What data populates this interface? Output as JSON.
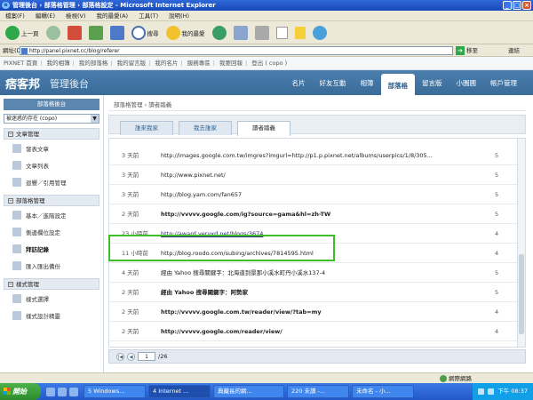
{
  "window": {
    "title": "管理後台 › 部落格管理 › 部落格設定 - Microsoft Internet Explorer",
    "min": "_",
    "max": "□",
    "close": "×"
  },
  "menubar": [
    "檔案(F)",
    "編輯(E)",
    "檢視(V)",
    "我的最愛(A)",
    "工具(T)",
    "說明(H)"
  ],
  "toolbar": {
    "back": "上一頁",
    "search": "搜尋",
    "favorites": "我的最愛"
  },
  "address": {
    "label": "網址(D)",
    "url": "http://panel.pixnet.cc/blog/referer",
    "go": "移至",
    "links": "連結"
  },
  "pixnav": [
    "PIXNET 首頁",
    "我的相簿",
    "我的部落格",
    "我的留言版",
    "我的名片",
    "服務專區",
    "我要回報",
    "登出 ( copo )"
  ],
  "header": {
    "logo": "痞客邦",
    "subtitle": "管理後台",
    "tabs": [
      "名片",
      "好友互動",
      "相簿",
      "部落格",
      "留言版",
      "小園圃",
      "帳戶管理"
    ],
    "active_tab": "部落格"
  },
  "sidebar": {
    "title": "部落格後台",
    "selected_blog": "被迷惑的存在 (copo)",
    "groups": [
      {
        "title": "文章管理",
        "items": [
          "發表文章",
          "文章列表",
          "迴響／引用管理"
        ]
      },
      {
        "title": "部落格管理",
        "items": [
          "基本／進階設定",
          "側邊欄位設定",
          "拜訪記錄",
          "匯入匯出備份"
        ]
      },
      {
        "title": "樣式管理",
        "items": [
          "樣式選擇",
          "樣式設計精靈"
        ]
      }
    ],
    "active_item": "拜訪記錄"
  },
  "main": {
    "breadcrumb": "部落格管理 › 讀者踏義",
    "subtabs": [
      "誰來我家",
      "我去誰家",
      "讀者踏義"
    ],
    "active_subtab": "讀者踏義",
    "rows": [
      {
        "time": "3 天前",
        "url": "http://images.google.com.tw/imgres?imgurl=http://p1.p.pixnet.net/albums/userpics/1/8/305...",
        "count": "5",
        "style": "normal"
      },
      {
        "time": "3 天前",
        "url": "http://www.pixnet.net/",
        "count": "5",
        "style": "normal"
      },
      {
        "time": "3 天前",
        "url": "http://blog.yam.com/fan657",
        "count": "5",
        "style": "normal"
      },
      {
        "time": "2 天前",
        "url": "http://vvvvv.google.com/ig?source=gama&hl=zh-TW",
        "count": "5",
        "style": "bold"
      },
      {
        "time": "23 小時前",
        "url": "http://award.veryxd.net/blogs/3674",
        "count": "4",
        "style": "link"
      },
      {
        "time": "11 小時前",
        "url": "http://blog.roodo.com/subing/archives/7814595.html",
        "count": "4",
        "style": "normal"
      },
      {
        "time": "4 天前",
        "url": "經由 Yahoo 搜尋關鍵字：北海道到景那小溪水町丹小溪水137-4",
        "count": "5",
        "style": "normal"
      },
      {
        "time": "2 天前",
        "url": "經由 Yahoo 搜尋關鍵字：阿勢家",
        "count": "5",
        "style": "bold"
      },
      {
        "time": "2 天前",
        "url": "http://vvvvv.google.com.tw/reader/view/?tab=my",
        "count": "4",
        "style": "bold"
      },
      {
        "time": "2 天前",
        "url": "http://vvvvv.google.com/reader/view/",
        "count": "4",
        "style": "bold"
      }
    ],
    "pager": {
      "page": "1",
      "total": "/26",
      "first": "|◀",
      "prev": "◀"
    }
  },
  "statusbar": {
    "zone": "網際網路"
  },
  "taskbar": {
    "start": "開始",
    "tasks": [
      "5 Windows...",
      "4 Internet ...",
      "典藏長的網...",
      "220 未讀 -...",
      "未命名 - 小..."
    ],
    "active_task": "4 Internet ...",
    "clock": "下午 08:37"
  }
}
